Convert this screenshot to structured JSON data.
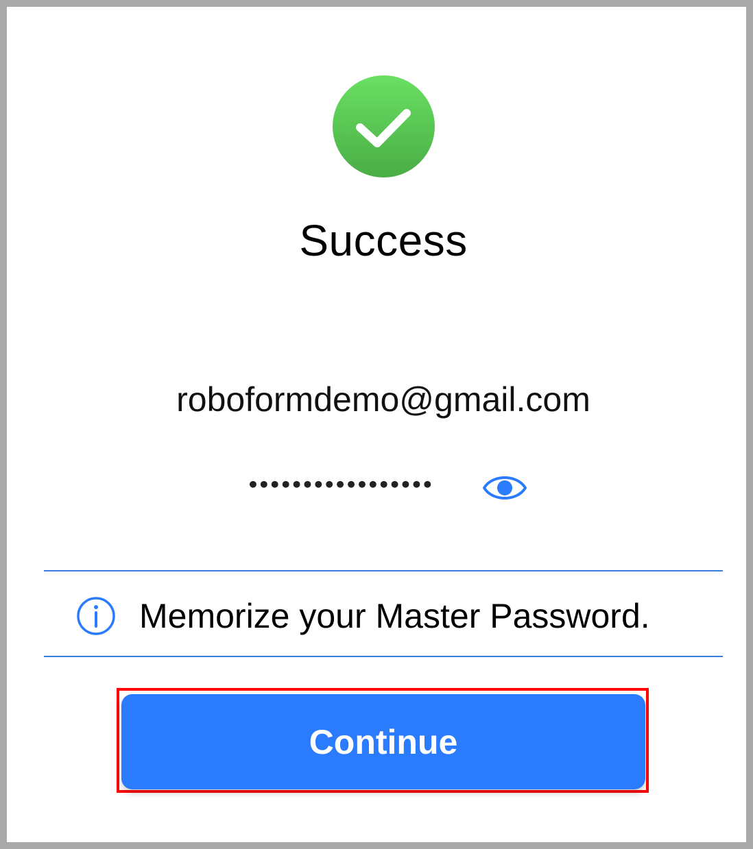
{
  "success": {
    "icon": "checkmark-circle-icon",
    "color": "#5cc653",
    "title": "Success"
  },
  "account": {
    "email": "roboformdemo@gmail.com",
    "masked_password": "•••••••••••••••••",
    "reveal_icon": "eye-icon"
  },
  "notice": {
    "icon": "info-icon",
    "text": "Memorize your Master Password."
  },
  "actions": {
    "continue_label": "Continue",
    "accent_color": "#2b7bff"
  }
}
